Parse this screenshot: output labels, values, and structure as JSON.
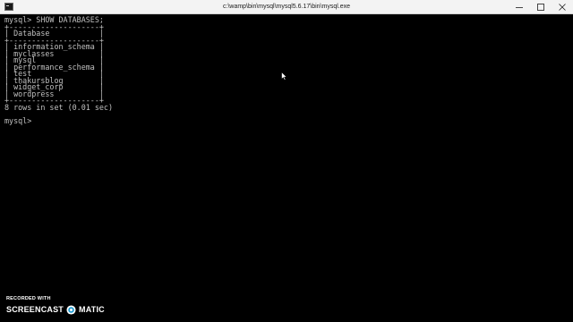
{
  "window": {
    "title": "c:\\wamp\\bin\\mysql\\mysql5.6.17\\bin\\mysql.exe"
  },
  "terminal": {
    "lines": [
      "mysql> SHOW DATABASES;",
      "+--------------------+",
      "| Database           |",
      "+--------------------+",
      "| information_schema |",
      "| myclasses          |",
      "| mysql              |",
      "| performance_schema |",
      "| test               |",
      "| thakursblog        |",
      "| widget_corp        |",
      "| wordpress          |",
      "+--------------------+",
      "8 rows in set (0.01 sec)",
      "",
      "mysql>"
    ]
  },
  "watermark": {
    "top_text": "RECORDED WITH",
    "left_word": "SCREENCAST",
    "right_word": "MATIC"
  },
  "colors": {
    "terminal_background": "#000000",
    "terminal_text": "#c0c0c0",
    "titlebar": "#f3f3f3",
    "watermark_logo": "#1f9bd1"
  },
  "icons": {
    "app": "console-icon",
    "minimize": "minimize-icon",
    "maximize": "maximize-icon",
    "close": "close-icon",
    "pointer": "mouse-pointer-icon",
    "watermark_logo": "screencast-o-matic-logo-icon"
  }
}
